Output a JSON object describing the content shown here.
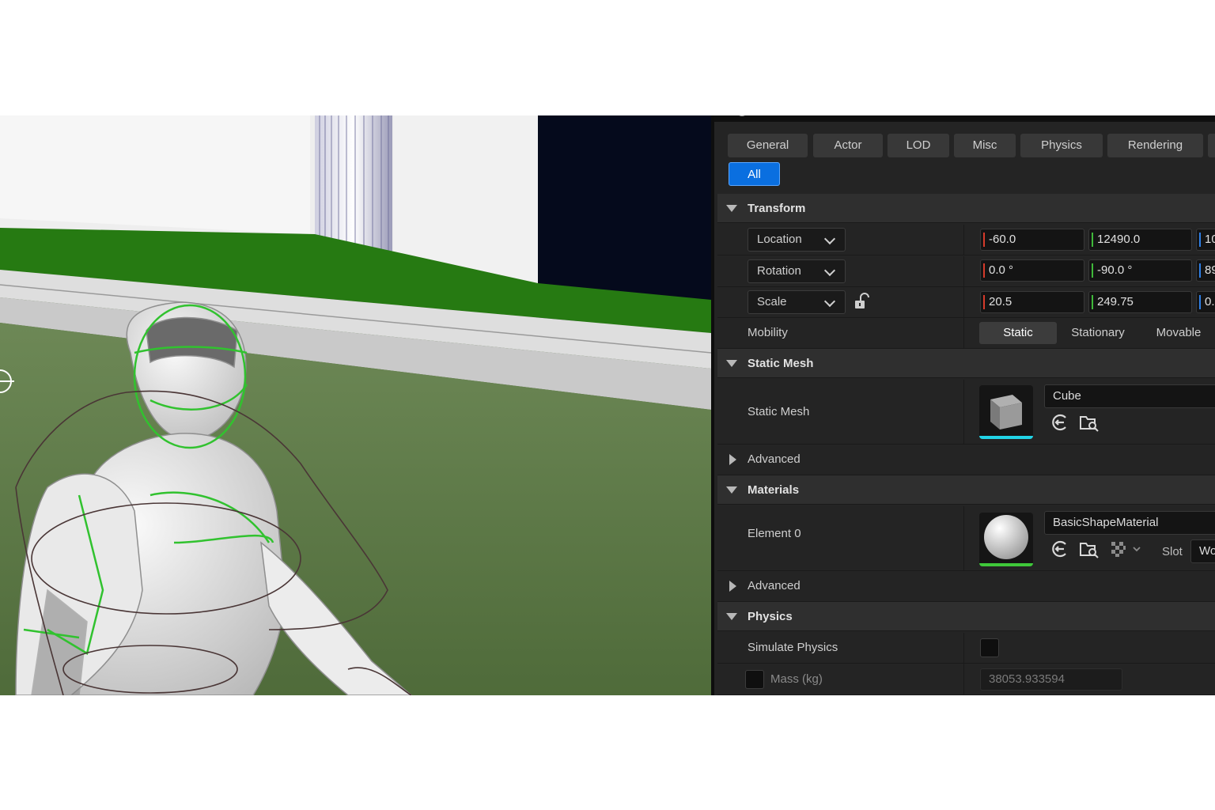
{
  "filter_tabs": [
    "General",
    "Actor",
    "LOD",
    "Misc",
    "Physics",
    "Rendering"
  ],
  "filter_all": "All",
  "transform": {
    "title": "Transform",
    "location": {
      "label": "Location",
      "x": "-60.0",
      "y": "12490.0",
      "z": "10"
    },
    "rotation": {
      "label": "Rotation",
      "x": "0.0 °",
      "y": "-90.0 °",
      "z": "89"
    },
    "scale": {
      "label": "Scale",
      "x": "20.5",
      "y": "249.75",
      "z": "0.2"
    },
    "mobility": {
      "label": "Mobility",
      "options": [
        "Static",
        "Stationary",
        "Movable"
      ],
      "selected": "Static"
    }
  },
  "static_mesh": {
    "title": "Static Mesh",
    "label": "Static Mesh",
    "asset": "Cube",
    "advanced": "Advanced"
  },
  "materials": {
    "title": "Materials",
    "element_label": "Element 0",
    "asset": "BasicShapeMaterial",
    "slot_label": "Slot",
    "slot_value": "Wo",
    "advanced": "Advanced"
  },
  "physics": {
    "title": "Physics",
    "simulate_label": "Simulate Physics",
    "mass_label": "Mass (kg)",
    "mass_value": "38053.933594"
  },
  "colors": {
    "accent": "#0a6fe0",
    "x_axis": "#d63a2a",
    "y_axis": "#3fb83a",
    "z_axis": "#2f7fe6",
    "ground": "#55733f",
    "wall": "#f2f2f2",
    "collision_green": "#31c22f"
  }
}
